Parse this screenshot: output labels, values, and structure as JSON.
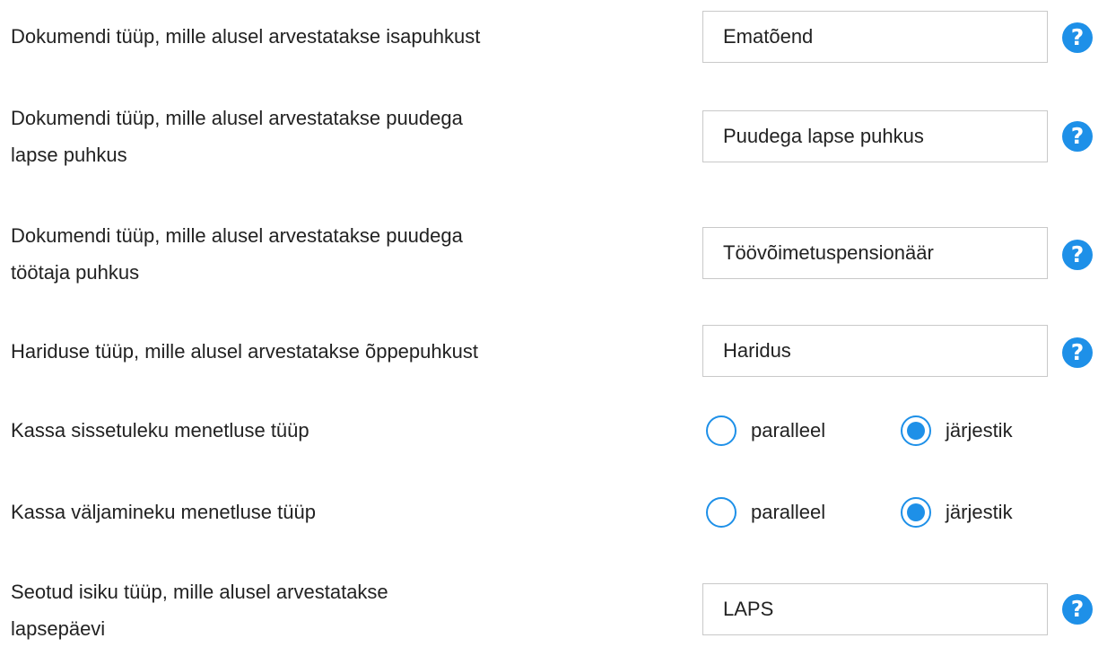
{
  "settings": {
    "row1": {
      "label": "Dokumendi tüüp, mille alusel arvestatakse isapuhkust",
      "value": "Ematõend"
    },
    "row2": {
      "label_line1": "Dokumendi tüüp, mille alusel arvestatakse puudega",
      "label_line2": "lapse puhkus",
      "value": "Puudega lapse puhkus"
    },
    "row3": {
      "label_line1": "Dokumendi tüüp, mille alusel arvestatakse puudega",
      "label_line2": "töötaja puhkus",
      "value": "Töövõimetuspensionäär"
    },
    "row4": {
      "label": "Hariduse tüüp, mille alusel arvestatakse õppepuhkust",
      "value": "Haridus"
    },
    "row5": {
      "label": "Kassa sissetuleku menetluse tüüp",
      "options": [
        "paralleel",
        "järjestik"
      ],
      "selected": "järjestik"
    },
    "row6": {
      "label": "Kassa väljamineku menetluse tüüp",
      "options": [
        "paralleel",
        "järjestik"
      ],
      "selected": "järjestik"
    },
    "row7": {
      "label_line1": "Seotud isiku tüüp, mille alusel arvestatakse",
      "label_line2": "lapsepäevi",
      "value": "LAPS"
    }
  },
  "help_icon_glyph": "?",
  "colors": {
    "accent": "#1e90e8",
    "text": "#222222",
    "border": "#c9c9c9"
  }
}
